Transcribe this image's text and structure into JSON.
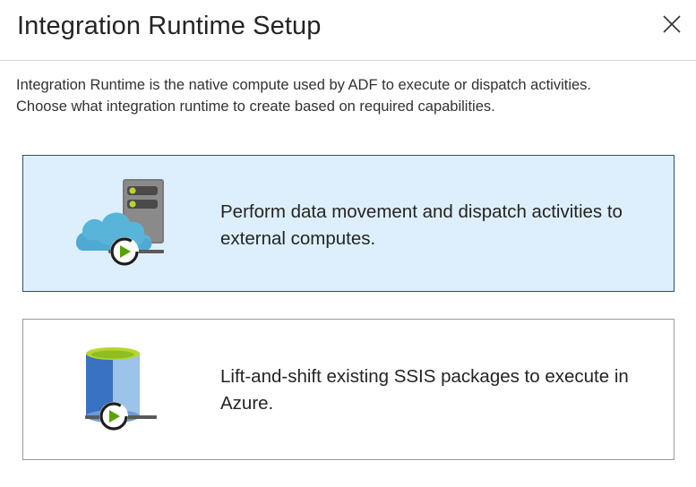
{
  "dialog": {
    "title": "Integration Runtime Setup",
    "close_icon": "close-icon"
  },
  "description": {
    "line1": "Integration Runtime is the native compute used by ADF to execute or dispatch activities.",
    "line2": "Choose what integration runtime to create based on required capabilities."
  },
  "options": [
    {
      "icon": "cloud-server-play-icon",
      "label": "Perform data movement and dispatch activities to external computes.",
      "selected": true
    },
    {
      "icon": "database-play-icon",
      "label": "Lift-and-shift existing SSIS packages to execute in Azure.",
      "selected": false
    }
  ],
  "colors": {
    "selected_background": "#ddeffd",
    "selected_border": "#2b4c7e",
    "unselected_border": "#9a9a9a",
    "play_green": "#57a300",
    "cloud_blue": "#59b4d9"
  }
}
